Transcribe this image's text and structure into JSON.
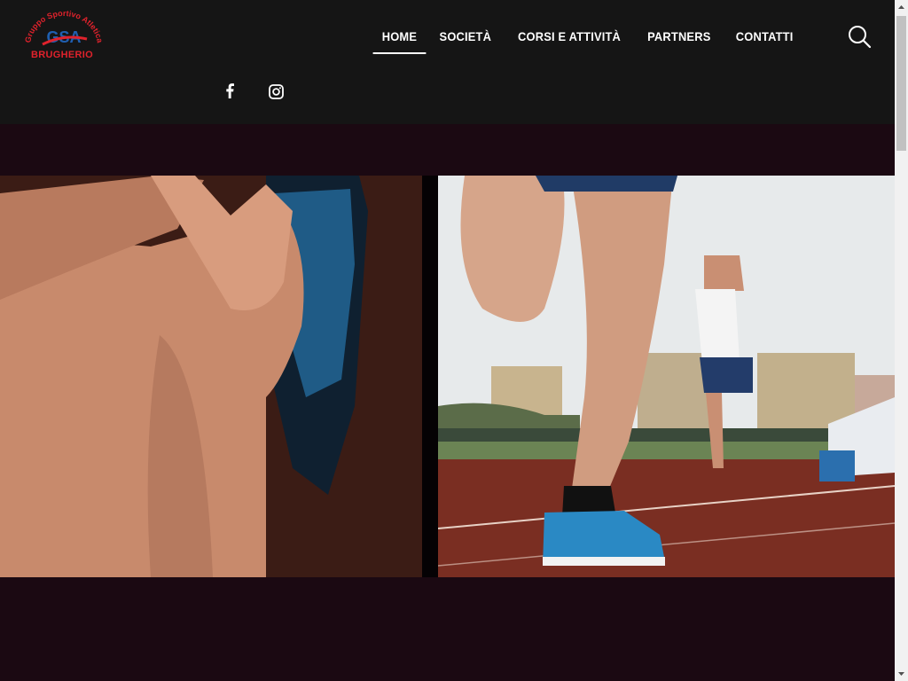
{
  "brand": {
    "arc_text": "Gruppo Sportivo Atletica",
    "monogram": "GSA",
    "city": "BRUGHERIO",
    "colors": {
      "red": "#e0222c",
      "blue": "#1f5fb0"
    }
  },
  "nav": {
    "items": [
      {
        "label": "HOME",
        "active": true
      },
      {
        "label": "SOCIETÀ",
        "active": false
      },
      {
        "label": "CORSI E ATTIVITÀ",
        "active": false
      },
      {
        "label": "PARTNERS",
        "active": false
      },
      {
        "label": "CONTATTI",
        "active": false
      }
    ]
  },
  "social": [
    "facebook-icon",
    "instagram-icon"
  ],
  "theme": {
    "header_bg": "#151515",
    "hero_bg": "#1b0912"
  }
}
